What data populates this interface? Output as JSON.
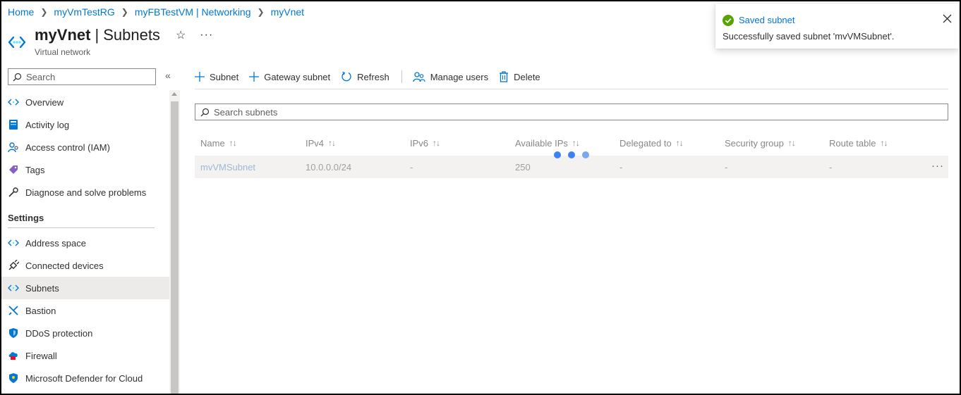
{
  "breadcrumb": [
    {
      "label": "Home"
    },
    {
      "label": "myVmTestRG"
    },
    {
      "label": "myFBTestVM | Networking"
    },
    {
      "label": "myVnet"
    }
  ],
  "header": {
    "resource_name": "myVnet",
    "separator": "|",
    "page_name": "Subnets",
    "subtitle": "Virtual network",
    "favorite_icon": "star-icon",
    "more_icon": "ellipsis-icon"
  },
  "sidebar": {
    "search_placeholder": "Search",
    "collapse_label": "«",
    "items": [
      {
        "label": "Overview",
        "icon": "vnet-icon"
      },
      {
        "label": "Activity log",
        "icon": "activity-log-icon"
      },
      {
        "label": "Access control (IAM)",
        "icon": "iam-icon"
      },
      {
        "label": "Tags",
        "icon": "tag-icon"
      },
      {
        "label": "Diagnose and solve problems",
        "icon": "wrench-icon"
      }
    ],
    "settings_header": "Settings",
    "settings_items": [
      {
        "label": "Address space",
        "icon": "vnet-icon"
      },
      {
        "label": "Connected devices",
        "icon": "plug-icon"
      },
      {
        "label": "Subnets",
        "icon": "vnet-icon",
        "active": true
      },
      {
        "label": "Bastion",
        "icon": "bastion-icon"
      },
      {
        "label": "DDoS protection",
        "icon": "shield-icon"
      },
      {
        "label": "Firewall",
        "icon": "firewall-icon"
      },
      {
        "label": "Microsoft Defender for Cloud",
        "icon": "defender-icon"
      }
    ]
  },
  "toolbar": {
    "subnet_label": "Subnet",
    "gateway_subnet_label": "Gateway subnet",
    "refresh_label": "Refresh",
    "manage_users_label": "Manage users",
    "delete_label": "Delete"
  },
  "search": {
    "placeholder": "Search subnets"
  },
  "table": {
    "sort_glyph": "↑↓",
    "columns": [
      "Name",
      "IPv4",
      "IPv6",
      "Available IPs",
      "Delegated to",
      "Security group",
      "Route table"
    ],
    "rows": [
      {
        "name": "mvVMSubnet",
        "ipv4": "10.0.0.0/24",
        "ipv6": "-",
        "available_ips": "250",
        "delegated_to": "-",
        "security_group": "-",
        "route_table": "-"
      }
    ],
    "row_more": "···"
  },
  "toast": {
    "title": "Saved subnet",
    "message": "Successfully saved subnet 'mvVMSubnet'.",
    "status_color": "#57a300"
  },
  "colors": {
    "accent": "#0078d4",
    "loader": "#3b82f6"
  }
}
